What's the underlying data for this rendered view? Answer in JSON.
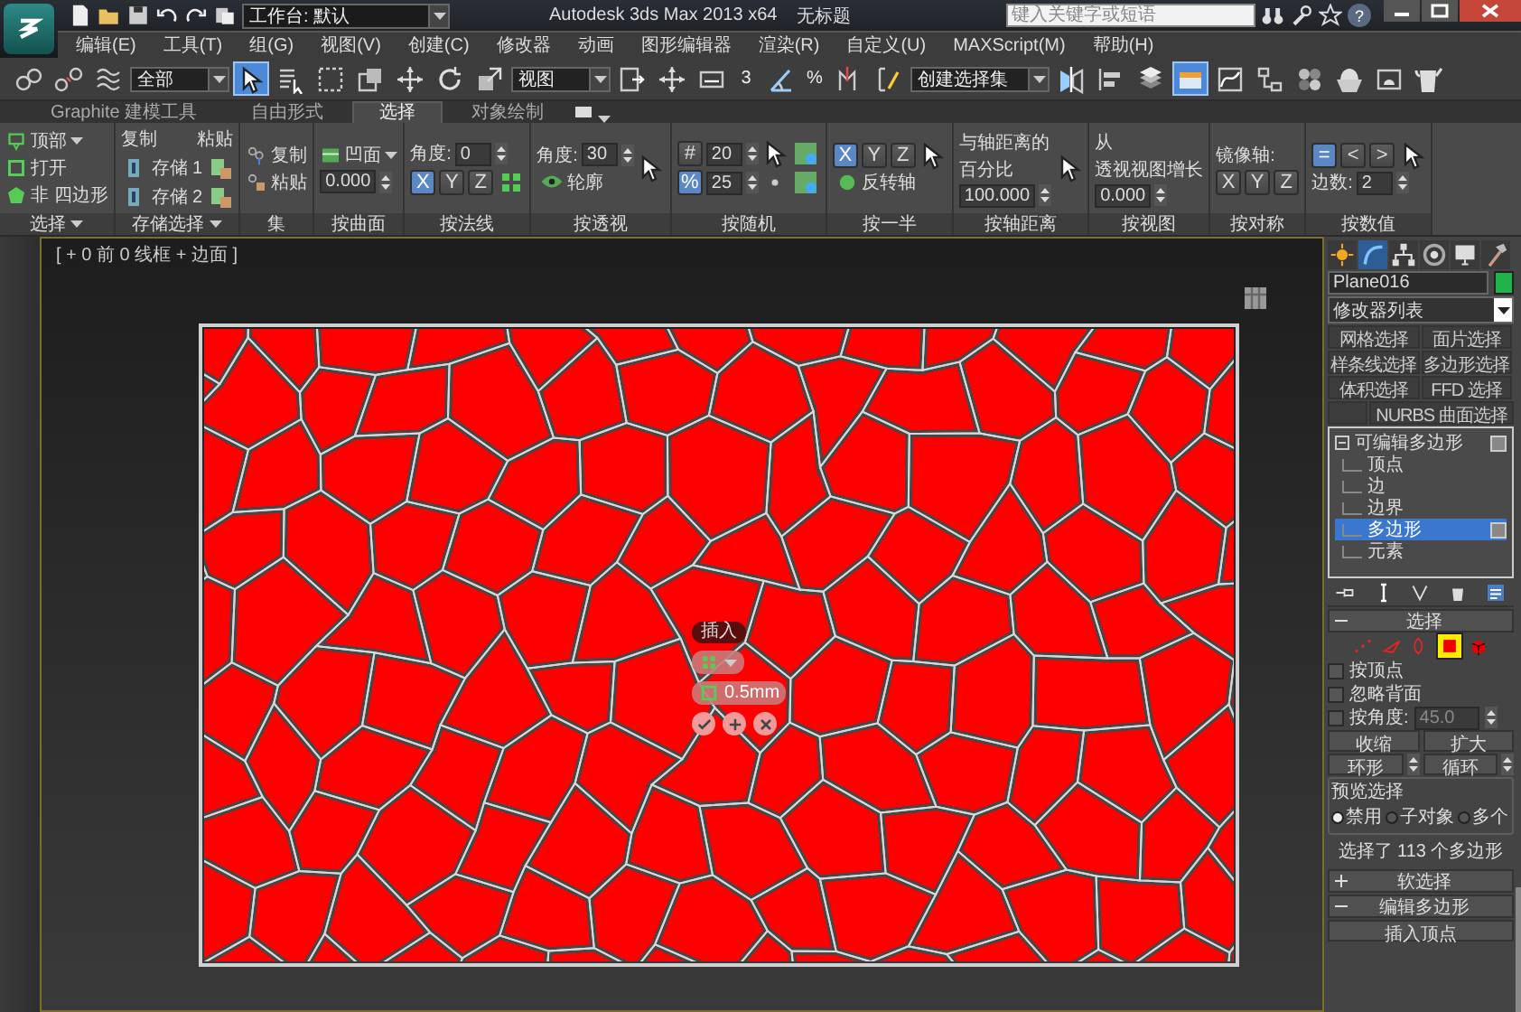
{
  "title_bar": {
    "workspace": "工作台: 默认",
    "title": "Autodesk 3ds Max  2013 x64",
    "document": "无标题",
    "search_placeholder": "键入关键字或短语",
    "help": "?"
  },
  "menu": [
    "编辑(E)",
    "工具(T)",
    "组(G)",
    "视图(V)",
    "创建(C)",
    "修改器",
    "动画",
    "图形编辑器",
    "渲染(R)",
    "自定义(U)",
    "MAXScript(M)",
    "帮助(H)"
  ],
  "toolbar": {
    "selection_filter": "全部",
    "select_object_on": true,
    "coordinate_system": "视图",
    "snap_label": "3",
    "percent_label": "%",
    "named_selection": "创建选择集",
    "graphite_on": true
  },
  "ribbon": {
    "tabs": [
      {
        "label": "Graphite 建模工具",
        "selected": false
      },
      {
        "label": "自由形式",
        "selected": false
      },
      {
        "label": "选择",
        "selected": true
      },
      {
        "label": "对象绘制",
        "selected": false
      }
    ],
    "groups": [
      {
        "kind": "select",
        "label": "选择",
        "menu": true,
        "rows": [
          {
            "label": "顶部",
            "menu": true
          },
          {
            "label": "打开",
            "menu": false
          },
          {
            "label": "非 四边形",
            "menu": false
          }
        ]
      },
      {
        "kind": "stored",
        "label": "存储选择",
        "menu": true,
        "copy": "复制",
        "paste": "粘贴",
        "slots": [
          "存储 1",
          "存储 2"
        ]
      },
      {
        "kind": "sets",
        "label": "集",
        "menu": false,
        "items": [
          "复制",
          "粘贴"
        ]
      },
      {
        "kind": "surface",
        "label": "按曲面",
        "menu": false,
        "mode": "凹面",
        "value": "0.000"
      },
      {
        "kind": "normal",
        "label": "按法线",
        "menu": false,
        "angle_label": "角度:",
        "angle": "0",
        "axes": [
          {
            "label": "X",
            "selected": true
          },
          {
            "label": "Y",
            "selected": false
          },
          {
            "label": "Z",
            "selected": false
          }
        ]
      },
      {
        "kind": "perspective",
        "label": "按透视",
        "menu": false,
        "angle_label": "角度:",
        "angle": "30",
        "outline": {
          "label": "轮廓",
          "checked": false
        }
      },
      {
        "kind": "random",
        "label": "按随机",
        "menu": false,
        "modes": [
          {
            "symbol": "#",
            "value": "20",
            "selected": false
          },
          {
            "symbol": "%",
            "value": "25",
            "selected": true
          }
        ]
      },
      {
        "kind": "half",
        "label": "按一半",
        "menu": false,
        "axes": [
          {
            "label": "X",
            "selected": true
          },
          {
            "label": "Y",
            "selected": false
          },
          {
            "label": "Z",
            "selected": false
          }
        ],
        "flip": {
          "label": "反转轴",
          "checked": false
        }
      },
      {
        "kind": "distance",
        "label": "按轴距离",
        "menu": false,
        "lines": [
          "与轴距离的",
          "百分比"
        ],
        "value": "100.000"
      },
      {
        "kind": "view",
        "label": "按视图",
        "menu": false,
        "lines": [
          "从",
          "透视视图增长"
        ],
        "value": "0.000"
      },
      {
        "kind": "symmetry",
        "label": "按对称",
        "menu": false,
        "caption": "镜像轴:",
        "axes": [
          {
            "label": "X",
            "selected": false
          },
          {
            "label": "Y",
            "selected": false
          },
          {
            "label": "Z",
            "selected": false
          }
        ]
      },
      {
        "kind": "numeric",
        "label": "按数值",
        "menu": false,
        "modes": [
          {
            "symbol": "=",
            "selected": true
          },
          {
            "symbol": "<",
            "selected": false
          },
          {
            "symbol": ">",
            "selected": false
          }
        ],
        "sides_label": "边数:",
        "value": "2"
      }
    ]
  },
  "viewport": {
    "label": "[ + 0 前 0 线框 + 边面 ]",
    "caddy": {
      "title": "插入",
      "value": "0.5mm"
    }
  },
  "command_panel": {
    "tabs": [
      {
        "selected": false
      },
      {
        "selected": true
      },
      {
        "selected": false
      },
      {
        "selected": false
      },
      {
        "selected": false
      },
      {
        "selected": false
      }
    ],
    "object_name": "Plane016",
    "modifier_list": "修改器列表",
    "modifier_buttons": [
      {
        "kind": "button",
        "label": "网格选择"
      },
      {
        "kind": "button",
        "label": "面片选择"
      },
      {
        "kind": "button",
        "label": "样条线选择"
      },
      {
        "kind": "button",
        "label": "多边形选择"
      },
      {
        "kind": "button",
        "label": "体积选择"
      },
      {
        "kind": "button",
        "label": "FFD 选择"
      },
      {
        "kind": "blank"
      },
      {
        "kind": "button",
        "label": "NURBS 曲面选择"
      }
    ],
    "stack": {
      "label": "可编辑多边形",
      "expanded": true,
      "children": [
        {
          "label": "顶点",
          "selected": false
        },
        {
          "label": "边",
          "selected": false
        },
        {
          "label": "边界",
          "selected": false
        },
        {
          "label": "多边形",
          "selected": true
        },
        {
          "label": "元素",
          "selected": false
        }
      ]
    },
    "selection": {
      "title": "选择",
      "expanded": true,
      "subobjects": [
        {
          "kind": "vertex",
          "selected": false
        },
        {
          "kind": "edge",
          "selected": false
        },
        {
          "kind": "border",
          "selected": false
        },
        {
          "kind": "polygon",
          "selected": true
        },
        {
          "kind": "element",
          "selected": false
        }
      ],
      "options": [
        {
          "label": "按顶点",
          "checked": false
        },
        {
          "label": "忽略背面",
          "checked": false
        },
        {
          "label": "按角度:",
          "checked": false
        }
      ],
      "angle": "45.0",
      "buttons": [
        "收缩",
        "扩大"
      ],
      "spinner_buttons": [
        "环形",
        "循环"
      ],
      "preview": {
        "title": "预览选择",
        "options": [
          {
            "label": "禁用",
            "selected": true
          },
          {
            "label": "子对象",
            "selected": false
          },
          {
            "label": "多个",
            "selected": false
          }
        ]
      },
      "status": "选择了 113 个多边形"
    },
    "rollouts": [
      {
        "title": "软选择",
        "expanded": false
      },
      {
        "title": "编辑多边形",
        "expanded": true
      }
    ],
    "insert_vertex": "插入顶点"
  }
}
